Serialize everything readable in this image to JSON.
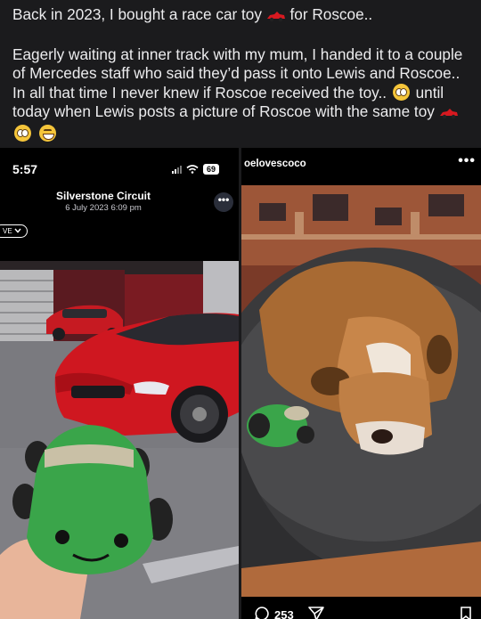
{
  "post": {
    "line1_pre": "Back in 2023, I bought a race car toy",
    "line1_post": "for Roscoe..",
    "para2_text": "Eagerly waiting at inner track with my mum, I handed it to a couple of Mercedes staff who said they’d pass it onto Lewis and Roscoe.. In all that time I never knew if Roscoe received the toy..",
    "para2_mid": "until today when Lewis posts a picture of Roscoe with the same toy",
    "emoji_icons": [
      "race-car-icon",
      "pleading-face-icon",
      "grinning-face-icon"
    ]
  },
  "left_screenshot": {
    "status_time": "5:57",
    "battery": "69",
    "location_title": "Silverstone Circuit",
    "date": "6 July 2023  6:09 pm",
    "more_glyph": "•••",
    "chip_label": "VE"
  },
  "right_screenshot": {
    "username": "oelovescoco",
    "more_glyph": "•••",
    "comment_count": "253"
  },
  "colors": {
    "background": "#1b1b1d",
    "car_red": "#c8141c",
    "plush_green": "#3aa54a",
    "bulldog_tan": "#a86a33"
  }
}
